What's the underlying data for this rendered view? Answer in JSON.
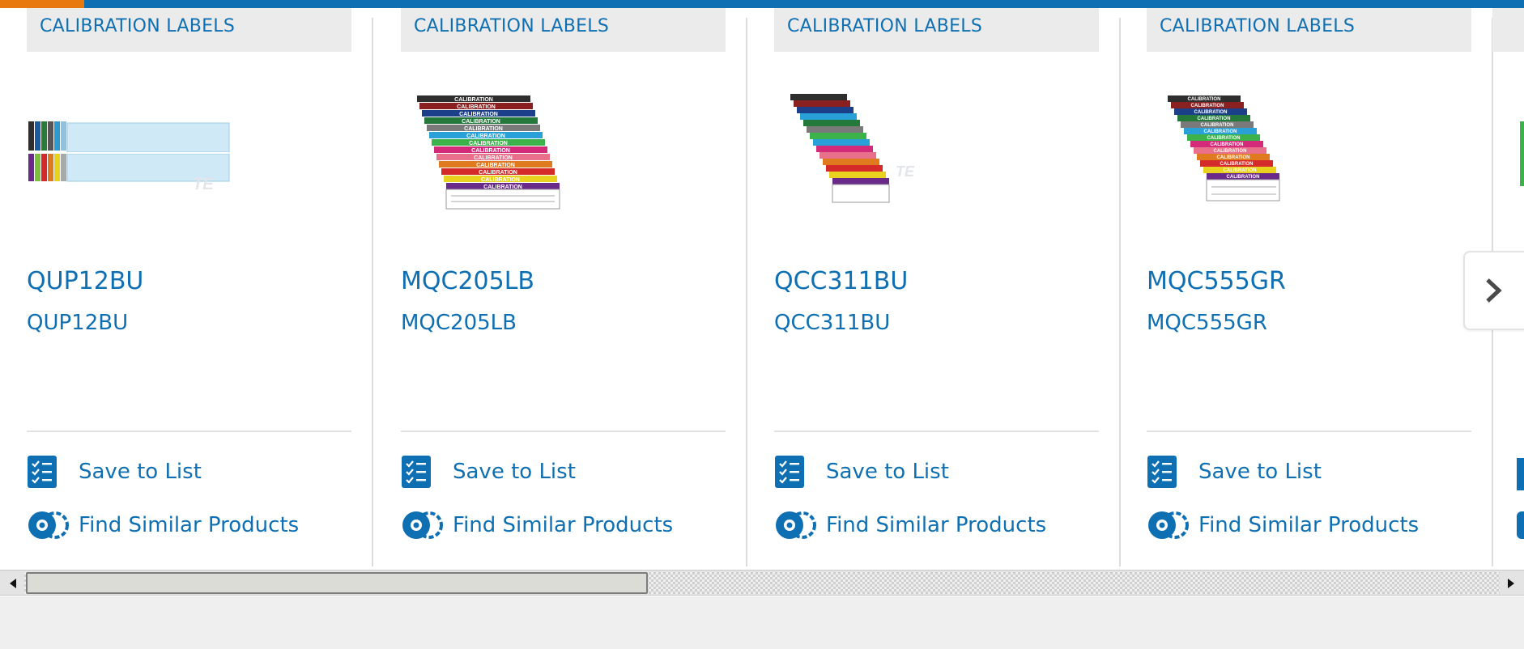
{
  "carousel": {
    "cards": [
      {
        "category": "CALIBRATION LABELS",
        "title": "QUP12BU",
        "subtitle": "QUP12BU",
        "save_label": "Save to List",
        "similar_label": "Find Similar Products"
      },
      {
        "category": "CALIBRATION LABELS",
        "title": "MQC205LB",
        "subtitle": "MQC205LB",
        "save_label": "Save to List",
        "similar_label": "Find Similar Products"
      },
      {
        "category": "CALIBRATION LABELS",
        "title": "QCC311BU",
        "subtitle": "QCC311BU",
        "save_label": "Save to List",
        "similar_label": "Find Similar Products"
      },
      {
        "category": "CALIBRATION LABELS",
        "title": "MQC555GR",
        "subtitle": "MQC555GR",
        "save_label": "Save to List",
        "similar_label": "Find Similar Products"
      }
    ],
    "label_strip_text": "CALIBRATION",
    "next_icon": "chevron-right-icon"
  },
  "colors": {
    "brand_blue": "#0f6fb3",
    "accent_orange": "#e8790f",
    "header_gray": "#ebebeb"
  }
}
